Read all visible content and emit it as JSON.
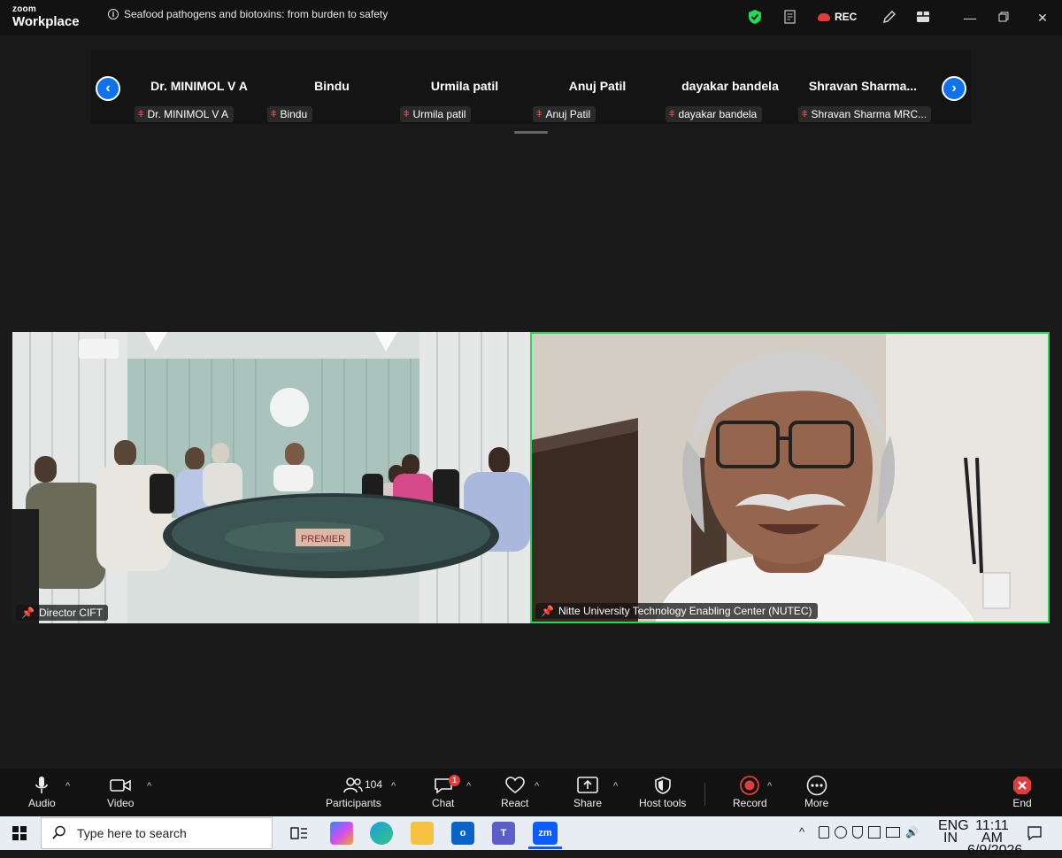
{
  "app": {
    "brand_line1": "zoom",
    "brand_line2": "Workplace"
  },
  "meeting": {
    "title": "Seafood pathogens and biotoxins: from burden to safety"
  },
  "titlebar": {
    "rec_label": "REC"
  },
  "participant_strip": {
    "participants": [
      {
        "name": "Dr. MINIMOL V A",
        "tag": "Dr. MINIMOL V A"
      },
      {
        "name": "Bindu",
        "tag": "Bindu"
      },
      {
        "name": "Urmila patil",
        "tag": "Urmila patil"
      },
      {
        "name": "Anuj Patil",
        "tag": "Anuj Patil"
      },
      {
        "name": "dayakar bandela",
        "tag": "dayakar bandela"
      },
      {
        "name": "Shravan  Sharma...",
        "tag": "Shravan Sharma MRC..."
      }
    ]
  },
  "videos": [
    {
      "label": "Director CIFT",
      "sign_text": "PREMIER"
    },
    {
      "label": "Nitte University Technology Enabling Center (NUTEC)",
      "active_speaker": true
    }
  ],
  "toolbar": {
    "audio": "Audio",
    "video": "Video",
    "participants": "Participants",
    "participants_count": "104",
    "chat": "Chat",
    "chat_badge": "1",
    "react": "React",
    "share": "Share",
    "host_tools": "Host tools",
    "record": "Record",
    "more": "More",
    "end": "End"
  },
  "taskbar": {
    "search_placeholder": "Type here to search",
    "apps": [
      "task-view",
      "copilot",
      "edge",
      "file-explorer",
      "outlook",
      "teams",
      "zoom"
    ],
    "zoom_label": "zm",
    "lang_line1": "ENG",
    "lang_line2": "IN",
    "time": "11:11 AM",
    "date": "6/9/2026"
  },
  "colors": {
    "accent": "#0e72ed",
    "active_speaker": "#23d959",
    "danger": "#e03c3c"
  }
}
